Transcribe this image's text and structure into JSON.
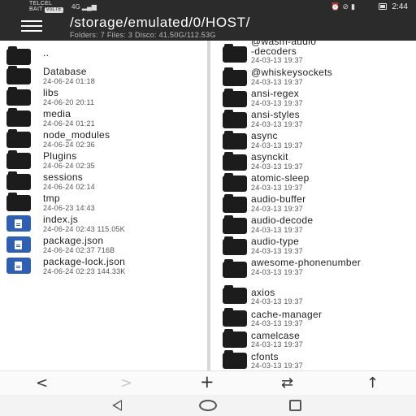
{
  "status": {
    "carrier_line1": "TELCEL",
    "carrier_line2": "BAIT",
    "volte": "VoLTE",
    "network": "4G",
    "time": "2:44"
  },
  "header": {
    "path": "/storage/emulated/0/HOST/",
    "info": "Folders: 7  Files: 3  Disco: 41.50G/112.53G"
  },
  "left_panel": {
    "items": [
      {
        "type": "folder",
        "name": "..",
        "meta": ""
      },
      {
        "type": "folder",
        "name": "Database",
        "meta": "24-06-24 01:18"
      },
      {
        "type": "folder",
        "name": "libs",
        "meta": "24-06-20 20:11"
      },
      {
        "type": "folder",
        "name": "media",
        "meta": "24-06-24 01:21"
      },
      {
        "type": "folder",
        "name": "node_modules",
        "meta": "24-06-24 02:36"
      },
      {
        "type": "folder",
        "name": "Plugins",
        "meta": "24-06-24 02:35"
      },
      {
        "type": "folder",
        "name": "sessions",
        "meta": "24-06-24 02:14"
      },
      {
        "type": "folder",
        "name": "tmp",
        "meta": "24-06-23 14:43"
      },
      {
        "type": "file",
        "name": "index.js",
        "meta": "24-06-24 02:43  115.05K"
      },
      {
        "type": "file",
        "name": "package.json",
        "meta": "24-06-24 02:37  716B"
      },
      {
        "type": "file",
        "name": "package-lock.json",
        "meta": "24-06-24 02:23  144.33K"
      }
    ]
  },
  "right_panel": {
    "items": [
      {
        "type": "folder",
        "name": "@wasm-audio-decoders",
        "name_line1": "@wasm-audio",
        "name_line2": "-decoders",
        "meta": "24-03-13 19:37"
      },
      {
        "type": "folder",
        "name": "@whiskeysockets",
        "meta": "24-03-13 19:37"
      },
      {
        "type": "folder",
        "name": "ansi-regex",
        "meta": "24-03-13 19:37"
      },
      {
        "type": "folder",
        "name": "ansi-styles",
        "meta": "24-03-13 19:37"
      },
      {
        "type": "folder",
        "name": "async",
        "meta": "24-03-13 19:37"
      },
      {
        "type": "folder",
        "name": "asynckit",
        "meta": "24-03-13 19:37"
      },
      {
        "type": "folder",
        "name": "atomic-sleep",
        "meta": "24-03-13 19:37"
      },
      {
        "type": "folder",
        "name": "audio-buffer",
        "meta": "24-03-13 19:37"
      },
      {
        "type": "folder",
        "name": "audio-decode",
        "meta": "24-03-13 19:37"
      },
      {
        "type": "folder",
        "name": "audio-type",
        "meta": "24-03-13 19:37"
      },
      {
        "type": "folder",
        "name": "awesome-phonenumber",
        "meta": "24-03-13 19:37"
      },
      {
        "type": "folder",
        "name": "axios",
        "meta": "24-03-13 19:37"
      },
      {
        "type": "folder",
        "name": "cache-manager",
        "meta": "24-03-13 19:37"
      },
      {
        "type": "folder",
        "name": "camelcase",
        "meta": "24-03-13 19:37"
      },
      {
        "type": "folder",
        "name": "cfonts",
        "meta": "24-03-13 19:37"
      }
    ]
  },
  "toolbar": {
    "back_icon": "chevron-left-icon",
    "forward_icon": "chevron-right-icon",
    "add_icon": "plus-icon",
    "swap_icon": "swap-arrows-icon",
    "up_icon": "arrow-up-icon",
    "back_glyph": "<",
    "forward_glyph": ">",
    "add_glyph": "+",
    "swap_glyph": "⇄",
    "up_glyph": "↑"
  },
  "colors": {
    "header_bg": "#2b2b2b",
    "file_icon": "#2f5fb3",
    "folder_icon": "#1c1c1c"
  }
}
